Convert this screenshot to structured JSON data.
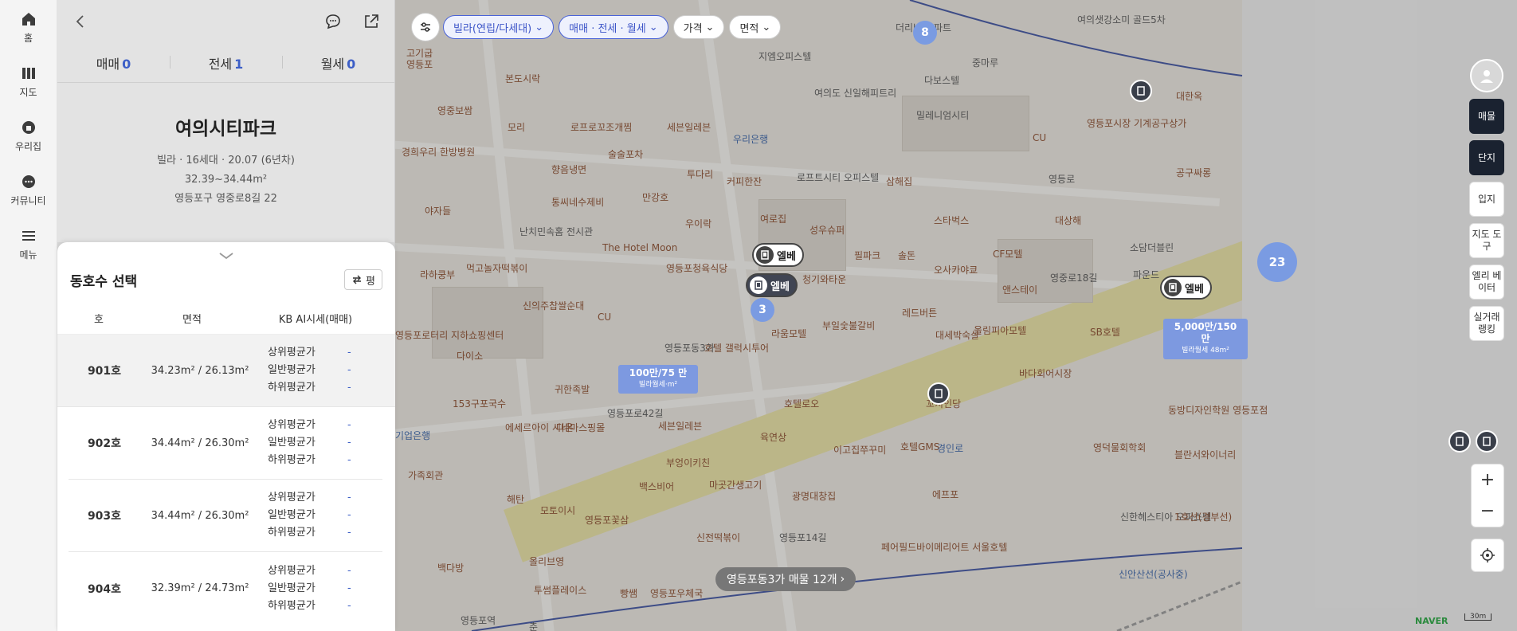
{
  "nav": {
    "items": [
      {
        "label": "홈",
        "icon": "home-icon"
      },
      {
        "label": "지도",
        "icon": "map-icon"
      },
      {
        "label": "우리집",
        "icon": "my-home-icon"
      },
      {
        "label": "커뮤니티",
        "icon": "community-icon"
      },
      {
        "label": "메뉴",
        "icon": "menu-icon"
      }
    ]
  },
  "panel": {
    "tabs": [
      {
        "label": "매매",
        "count": "0"
      },
      {
        "label": "전세",
        "count": "1"
      },
      {
        "label": "월세",
        "count": "0"
      }
    ],
    "title": "여의시티파크",
    "info1": "빌라 · 16세대 · 20.07 (6년차)",
    "info2": "32.39~34.44m²",
    "address": "영등포구 영중로8길 22"
  },
  "sheet": {
    "title": "동호수 선택",
    "unit_toggle": "평",
    "headers": {
      "unit": "호",
      "area": "면적",
      "price": "KB AI시세(매매)"
    },
    "price_labels": [
      "상위평균가",
      "일반평균가",
      "하위평균가"
    ],
    "rows": [
      {
        "unit": "901호",
        "area": "34.23m² / 26.13m²",
        "values": [
          "-",
          "-",
          "-"
        ]
      },
      {
        "unit": "902호",
        "area": "34.44m² / 26.30m²",
        "values": [
          "-",
          "-",
          "-"
        ]
      },
      {
        "unit": "903호",
        "area": "34.44m² / 26.30m²",
        "values": [
          "-",
          "-",
          "-"
        ]
      },
      {
        "unit": "904호",
        "area": "32.39m² / 24.73m²",
        "values": [
          "-",
          "-",
          "-"
        ]
      }
    ]
  },
  "filters": {
    "type": "빌라(연립/다세대)",
    "deal": "매매 · 전세 · 월세",
    "price": "가격",
    "area": "면적"
  },
  "rightbar": {
    "buttons": [
      "매물",
      "단지",
      "입지",
      "지도 도구",
      "엘리 베이터",
      "실거래 랭킹"
    ]
  },
  "map": {
    "markers": {
      "elevator1": "엘베",
      "elevator2": "엘베",
      "elevator3": "엘베"
    },
    "prices": [
      {
        "main": "100만/75 만",
        "sub": "빌라월세·m²"
      },
      {
        "main": "5,000만/150 만",
        "sub": "빌라월세 48m²"
      }
    ],
    "clusters": [
      "8",
      "3",
      "23"
    ],
    "labels": [
      "고기굽",
      "영등포",
      "본도시락",
      "영중보쌈",
      "모리",
      "로프로꼬조개찜",
      "세븐일레븐",
      "향음냉면",
      "술술포차",
      "투다리",
      "우리은행",
      "경희우리 한방병원",
      "야자들",
      "통씨네수제비",
      "만강호",
      "커피한잔",
      "로프트시티 오피스텔",
      "삼해집",
      "여의도 신일해피트리",
      "밀레니엄시티",
      "지엠오피스텔",
      "다보스텔",
      "더리버 아파트",
      "여의샛강소미 골드5차",
      "영등포시장 기계공구상가",
      "대한옥",
      "공구싸롱",
      "CU",
      "영등로",
      "우이락",
      "여로집",
      "성우슈퍼",
      "스타벅스",
      "대상해",
      "소담더블린",
      "난치민속홈 전시관",
      "The Hotel Moon",
      "먹고놀자떡볶이",
      "영등포청육식당",
      "필파크",
      "솔돈",
      "오사카야쿄",
      "CF모텔",
      "라하쿵부",
      "신의주찹쌀순대",
      "청기와타운",
      "앤스테이",
      "영중로18길",
      "파운드",
      "CU",
      "부일숯불갈비",
      "레드버튼",
      "올림피아모텔",
      "SB호텔",
      "영등포로터리 지하쇼핑센터",
      "다이소",
      "대세박숙살",
      "라움모텔",
      "호텔 갤럭시투어",
      "바다회어시장",
      "153구포국수",
      "귀한족발",
      "영등포로42길",
      "세븐일레븐",
      "호텔로오",
      "꼬치인당",
      "에세르아이 시네마스핑몰",
      "다온",
      "육연상",
      "이고집쭈꾸미",
      "호텔GMS",
      "기업은행",
      "부엉이키친",
      "가족회관",
      "마곳간생고기",
      "백스비어",
      "광명대창집",
      "해탄",
      "모토이시",
      "영등포꽃삼",
      "신전떡볶이",
      "동방디자인학원 영등포점",
      "영덕물회학회",
      "블란서와이너리",
      "신한헤스티아 오피스텔",
      "페어필드바이메리어트 서울호텔",
      "올리브영",
      "영등포동3가",
      "백다방",
      "투썸플레이스",
      "빵쌤",
      "영등포우체국",
      "영등포역",
      "춘",
      "에프포",
      "1호선(경부선)",
      "신안산선(공사중)",
      "경인로",
      "영등포14길",
      "중마루"
    ]
  },
  "toast": "영등포동3가 매물 12개",
  "brand": "NAVER",
  "scale": "30m",
  "colors": {
    "accent": "#3d5fc7",
    "marker_dark": "#3a3f4a",
    "price_chip": "#7d99e0"
  }
}
